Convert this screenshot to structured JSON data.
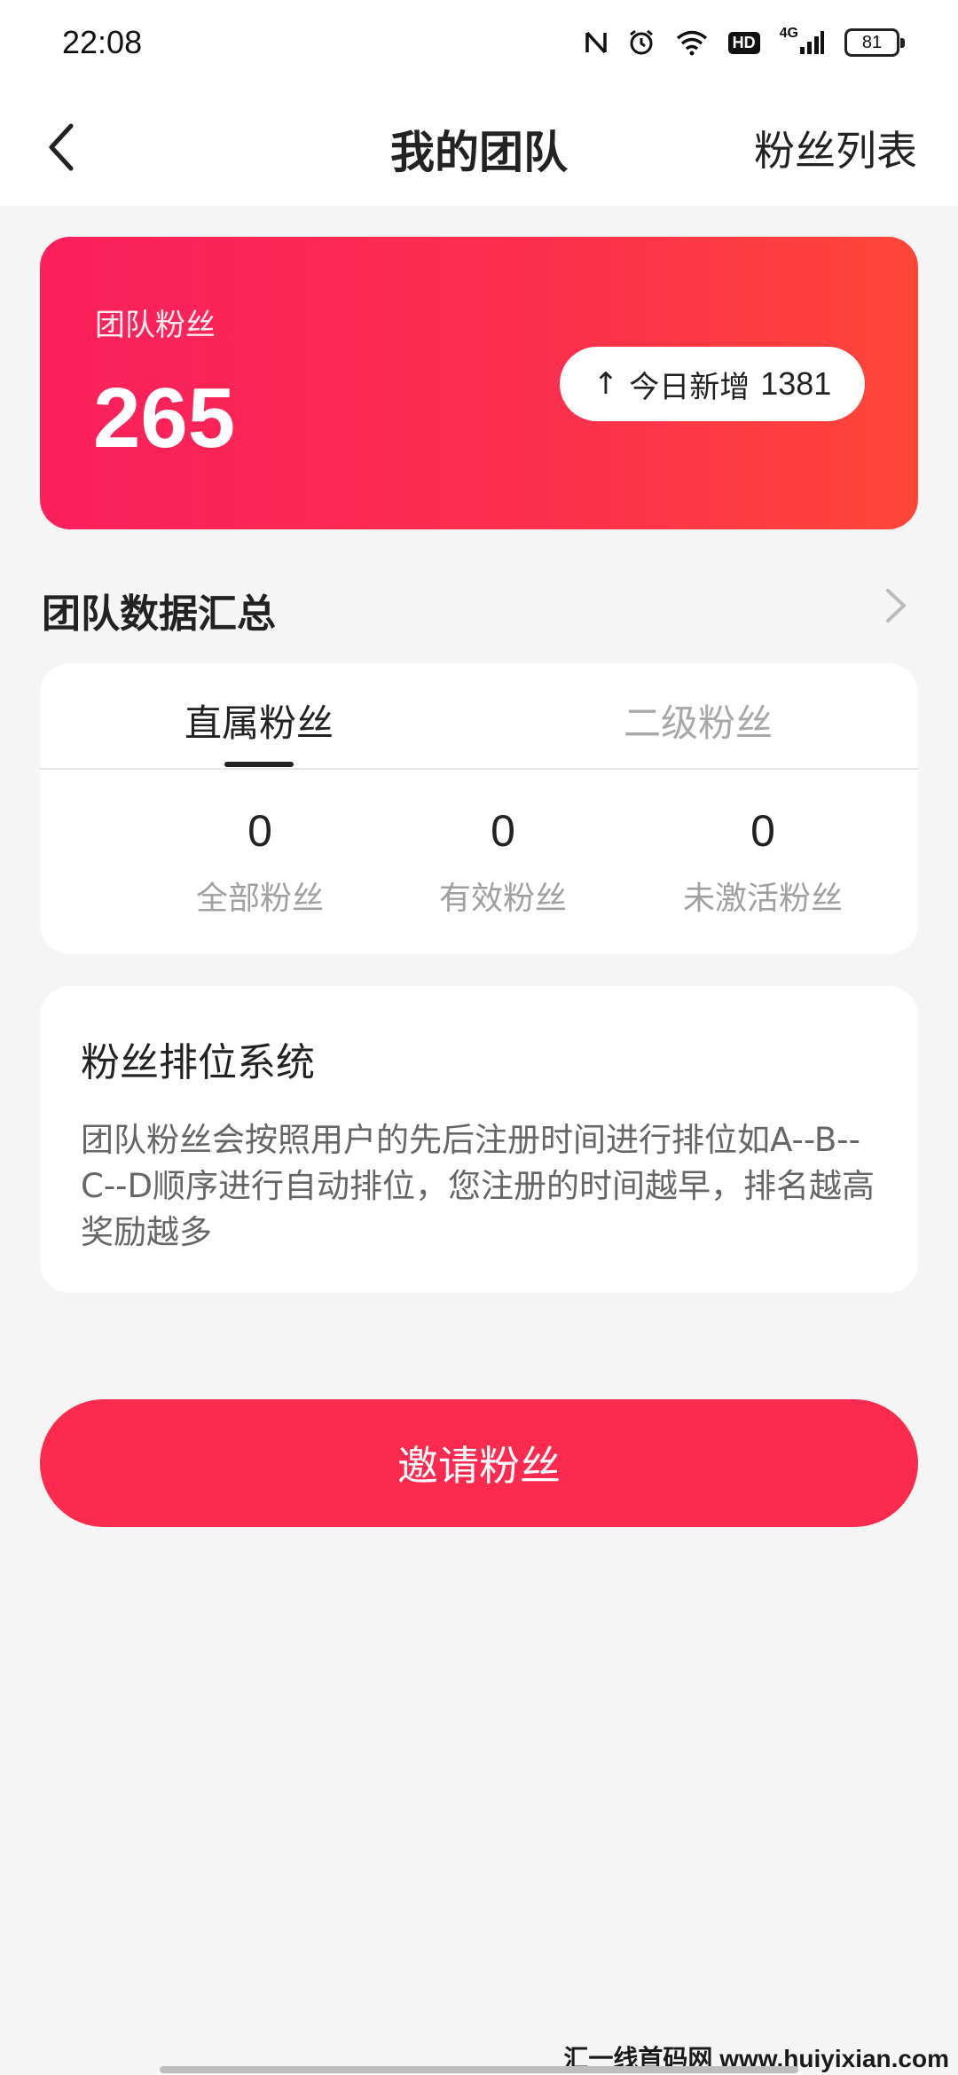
{
  "status_bar": {
    "time": "22:08",
    "net_label": "4G",
    "hd_label": "HD",
    "battery": "81"
  },
  "nav": {
    "title": "我的团队",
    "right_action": "粉丝列表"
  },
  "team_card": {
    "label": "团队粉丝",
    "value": "265",
    "today_label": "今日新增",
    "today_value": "1381"
  },
  "summary": {
    "title": "团队数据汇总"
  },
  "tabs": [
    {
      "label": "直属粉丝",
      "active": true
    },
    {
      "label": "二级粉丝",
      "active": false
    }
  ],
  "stats": [
    {
      "value": "0",
      "label": "全部粉丝"
    },
    {
      "value": "0",
      "label": "有效粉丝"
    },
    {
      "value": "0",
      "label": "未激活粉丝"
    }
  ],
  "rank": {
    "title": "粉丝排位系统",
    "description": "团队粉丝会按照用户的先后注册时间进行排位如A--B--C--D顺序进行自动排位，您注册的时间越早，排名越高奖励越多"
  },
  "invite_button": "邀请粉丝",
  "watermark": "汇一线首码网 www.huiyixian.com",
  "colors": {
    "card_gradient_start": "#fb1f5c",
    "card_gradient_end": "#fd4639",
    "button": "#fb2a4e",
    "background": "#f5f5f5"
  }
}
